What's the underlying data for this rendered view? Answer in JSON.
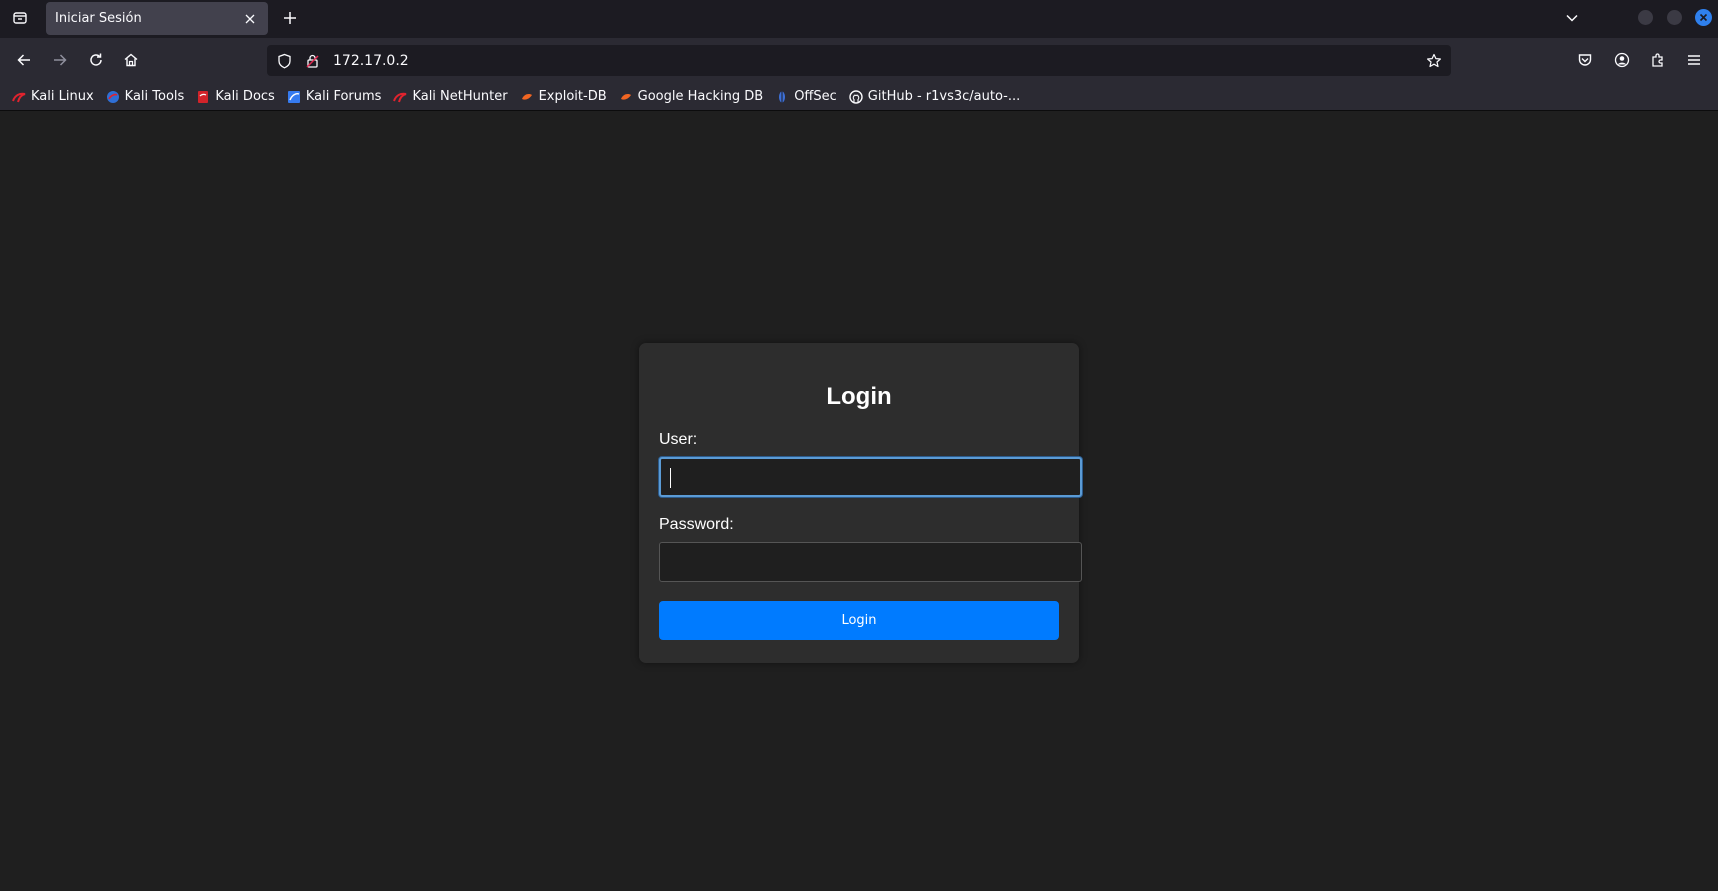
{
  "browser": {
    "tab": {
      "title": "Iniciar Sesión"
    },
    "url": "172.17.0.2",
    "bookmarks": [
      {
        "label": "Kali Linux",
        "icon": "kali-dragon-icon",
        "color": "#e0232e"
      },
      {
        "label": "Kali Tools",
        "icon": "kali-tools-icon",
        "color": "#2f6fd6"
      },
      {
        "label": "Kali Docs",
        "icon": "kali-docs-icon",
        "color": "#d2232a"
      },
      {
        "label": "Kali Forums",
        "icon": "kali-forums-icon",
        "color": "#367bf0"
      },
      {
        "label": "Kali NetHunter",
        "icon": "nethunter-icon",
        "color": "#e0232e"
      },
      {
        "label": "Exploit-DB",
        "icon": "exploit-db-icon",
        "color": "#f16522"
      },
      {
        "label": "Google Hacking DB",
        "icon": "ghdb-icon",
        "color": "#f16522"
      },
      {
        "label": "OffSec",
        "icon": "offsec-icon",
        "color": "#3d6fd6"
      },
      {
        "label": "GitHub - r1vs3c/auto-...",
        "icon": "github-icon",
        "color": "#ffffff"
      }
    ]
  },
  "login": {
    "title": "Login",
    "user_label": "User:",
    "user_value": "",
    "password_label": "Password:",
    "password_value": "",
    "button_label": "Login",
    "accent_color": "#007bff"
  }
}
